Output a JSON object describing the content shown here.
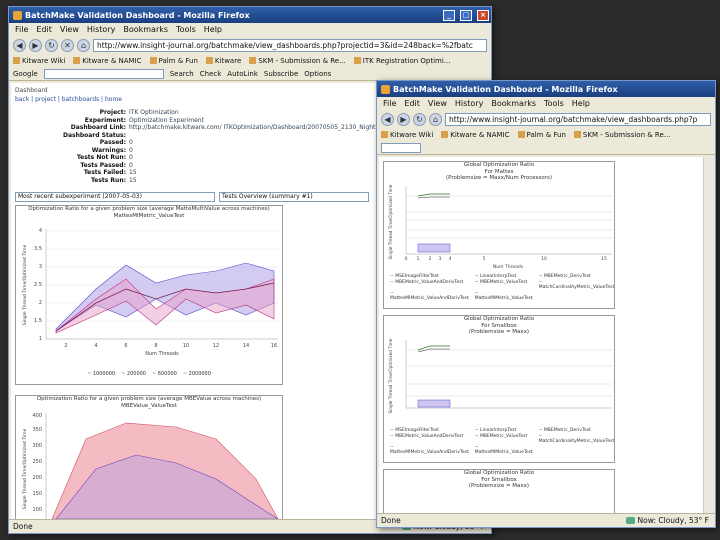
{
  "window1": {
    "title": "BatchMake Validation Dashboard - Mozilla Firefox",
    "menu": [
      "File",
      "Edit",
      "View",
      "History",
      "Bookmarks",
      "Tools",
      "Help"
    ],
    "url": "http://www.insight-journal.org/batchmake/view_dashboards.php?projectid=3&id=248back=%2fbatc",
    "bookmarks": [
      "Kitware Wiki",
      "Kitware & NAMIC",
      "Palm & Fun",
      "Kitware",
      "SKM - Submission & Re...",
      "ITK Registration Optimi..."
    ],
    "gbar": [
      "Google",
      "Search",
      "Check",
      "AutoLink",
      "Subscribe",
      "Options"
    ],
    "status": "Done",
    "weather": "Now: Cloudy, 53° F",
    "page": {
      "section": "Dashboard",
      "navlinks": "back | project | batchboards | home",
      "info": [
        {
          "k": "Project:",
          "v": "ITK Optimization"
        },
        {
          "k": "Experiment:",
          "v": "Optimization Experiment"
        },
        {
          "k": "Dashboard Link:",
          "v": "http://batchmake.kitware.com/ ITKOptimization/Dashboard/20070505_2130_Nightly Dashboard.html"
        },
        {
          "k": "Dashboard Status:",
          "v": ""
        },
        {
          "k": "Passed:",
          "v": "0"
        },
        {
          "k": "Warnings:",
          "v": "0"
        },
        {
          "k": "Tests Not Run:",
          "v": "0"
        },
        {
          "k": "Tests Passed:",
          "v": "0"
        },
        {
          "k": "Tests Failed:",
          "v": "15"
        },
        {
          "k": "Tests Run:",
          "v": "15"
        }
      ],
      "select1": "Most recent subexperiment (2007-05-03)",
      "select2": "Tests Overview (summary #1)",
      "chart1_title": [
        "Optimization Ratio for a given problem size (average MatteMultiValue across machines)",
        "MattesMIMetric_ValueTest"
      ],
      "chart1_xlabel": "Num Threads",
      "chart1_ylabel": "Single Thread Time/Optimized Time",
      "chart1_yticks": [
        "1",
        "1.5",
        "2",
        "2.5",
        "3",
        "3.5",
        "4"
      ],
      "chart1_xticks": [
        "2",
        "4",
        "6",
        "8",
        "10",
        "12",
        "14",
        "16"
      ],
      "chart1_legend": [
        "1000000",
        "200000",
        "600000",
        "2000000"
      ],
      "chart2_title": [
        "Optimization Ratio for a given problem size (average MBEValue across machines)",
        "MBEValue_ValueTest"
      ],
      "chart2_ylabel": "Single Thread Time/Optimized Time",
      "chart2_yticks": [
        "400",
        "350",
        "300",
        "250",
        "200",
        "150",
        "100"
      ]
    }
  },
  "window2": {
    "title": "BatchMake Validation Dashboard - Mozilla Firefox",
    "menu": [
      "File",
      "Edit",
      "View",
      "History",
      "Bookmarks",
      "Tools",
      "Help"
    ],
    "url": "http://www.insight-journal.org/batchmake/view_dashboards.php?p",
    "bookmarks": [
      "Kitware Wiki",
      "Kitware & NAMIC",
      "Palm & Fun",
      "SKM - Submission & Re..."
    ],
    "status": "Done",
    "weather": "Now: Cloudy, 53° F",
    "chartA_title": [
      "Global Optimization Ratio",
      "For Mattes",
      "(Problemsize = Maxx/Num Processors)"
    ],
    "chartA_ylabel": "Single Thread Time/Optimized Time",
    "chartA_xlabel": "Num Threads",
    "chartA_xticks": [
      "0",
      "1",
      "2",
      "3",
      "4",
      "5",
      "10",
      "15"
    ],
    "chartB_title": [
      "Global Optimization Ratio",
      "For Smallbox",
      "(Problemsize = Maxx)"
    ],
    "chartB_ylabel": "Single Thread Time/Optimized Time",
    "chartC_title": [
      "Global Optimization Ratio",
      "For Smallbox",
      "(Problemsize = Maxx)"
    ],
    "legend": [
      "MSEImageFilterTest",
      "LinearInterpTest",
      "MBEMetric_DerivTest",
      "MBEMetric_ValueAndDerivTest",
      "MBEMetric_ValueTest",
      "MatchCardinalityMetric_ValueTest",
      "MattesMIMetric_ValueAndDerivTest",
      "MattesMIMetric_ValueTest",
      ""
    ]
  }
}
